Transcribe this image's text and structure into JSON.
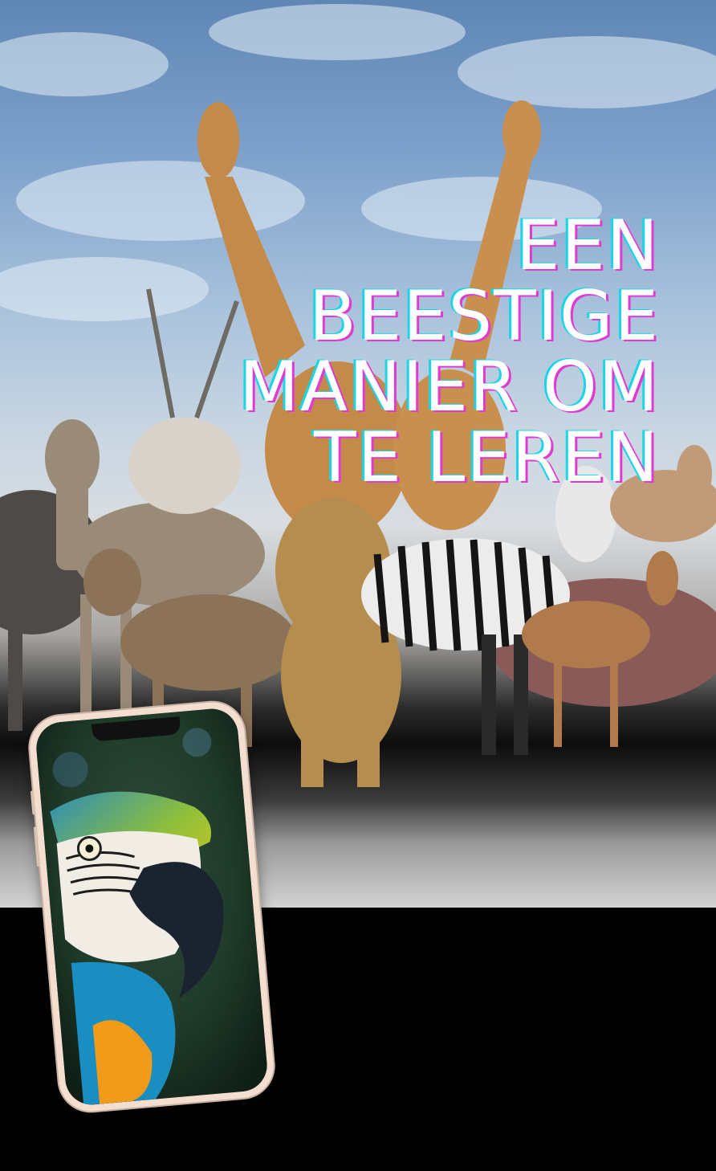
{
  "headline": {
    "line1": "EEN",
    "line2": "BEESTIGE",
    "line3": "MANIER OM",
    "line4": "TE LEREN",
    "text_color": "#ffffff",
    "glitch_colors": [
      "#e03bd0",
      "#19d6e6"
    ]
  },
  "scene": {
    "subjects": [
      "giraffe-image",
      "giraffe-image",
      "kudu-image",
      "oryx-image",
      "hyena-image",
      "lion-image",
      "zebra-image",
      "impala-image",
      "hippo-image",
      "ostrich-image",
      "wildebeest-image"
    ]
  },
  "phone": {
    "screen_subject": "macaw-parrot-image",
    "frame_color": "#f3ded0"
  }
}
